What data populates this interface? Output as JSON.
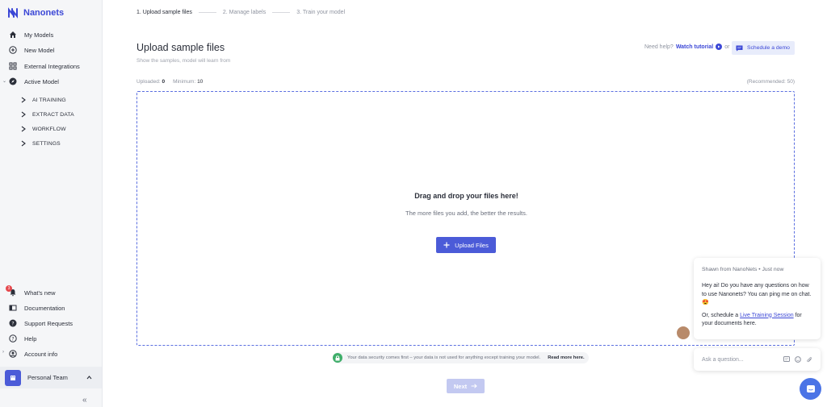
{
  "brand": {
    "name": "Nanonets"
  },
  "sidebar": {
    "items": [
      {
        "label": "My Models",
        "icon": "home-icon"
      },
      {
        "label": "New Model",
        "icon": "plus-circle-icon"
      },
      {
        "label": "External Integrations",
        "icon": "grid-icon"
      },
      {
        "label": "Active Model",
        "icon": "compass-icon"
      }
    ],
    "sub_items": [
      {
        "label": "AI TRAINING"
      },
      {
        "label": "EXTRACT DATA"
      },
      {
        "label": "WORKFLOW"
      },
      {
        "label": "SETTINGS"
      }
    ],
    "bottom_items": [
      {
        "label": "What's new",
        "icon": "bell-icon",
        "badge": "3"
      },
      {
        "label": "Documentation",
        "icon": "book-icon"
      },
      {
        "label": "Support Requests",
        "icon": "help-bubble-icon"
      },
      {
        "label": "Help",
        "icon": "question-icon"
      },
      {
        "label": "Account info",
        "icon": "user-circle-icon"
      }
    ],
    "team": {
      "label": "Personal Team"
    },
    "collapse_glyph": "«"
  },
  "stepper": {
    "steps": [
      {
        "label": "1.  Upload sample files"
      },
      {
        "label": "2.  Manage labels"
      },
      {
        "label": "3.  Train your model"
      }
    ]
  },
  "header": {
    "title": "Upload sample files",
    "subtitle": "Show the samples, model will learn from",
    "help_prefix": "Need help?",
    "watch_tutorial": "Watch tutorial",
    "or": "or",
    "schedule_demo": "Schedule a demo"
  },
  "counts": {
    "uploaded_label": "Uploaded:",
    "uploaded_value": "0",
    "minimum_label": "Minimum:",
    "minimum_value": "10",
    "recommended": "(Recommended: 50)"
  },
  "dropzone": {
    "title": "Drag and drop your files here!",
    "subtitle": "The more files you add, the better the results.",
    "upload_button": "Upload Files"
  },
  "security": {
    "text": "Your data security comes first – your data is not used for anything except training your model.",
    "link": "Read more here."
  },
  "next_button": "Next",
  "chat": {
    "from": "Shawn from NanoNets • Just now",
    "message": "Hey ai! Do you have any questions on how to use Nanonets? You can ping me on chat. 😍",
    "message2_prefix": "Or, schedule a ",
    "message2_link": "Live Training Session",
    "message2_suffix": " for your documents here.",
    "input_placeholder": "Ask a question..."
  },
  "colors": {
    "accent": "#4b5bd8",
    "link": "#3b47d6",
    "disabled": "#c3c9f1"
  }
}
